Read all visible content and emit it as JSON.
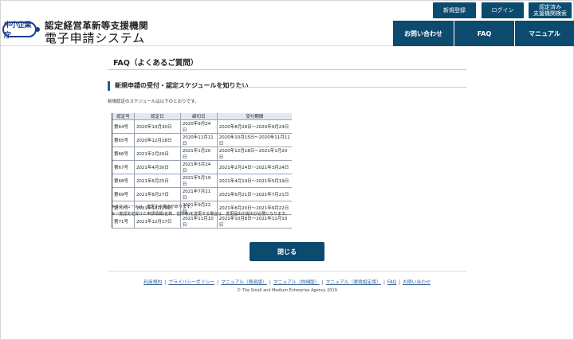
{
  "header": {
    "logo_badge": "中小企業庁",
    "brand_sub": "認定経営革新等支援機関",
    "brand_main": "電子申請システム",
    "top_buttons": {
      "register": "新規登録",
      "login": "ログイン",
      "search_line1": "認定済み",
      "search_line2": "支援機関検索"
    },
    "nav": {
      "contact": "お問い合わせ",
      "faq": "FAQ",
      "manual": "マニュアル"
    }
  },
  "main": {
    "page_title": "FAQ（よくあるご質問）",
    "section_title": "新規申請の受付・認定スケジュールを知りたい",
    "intro": "新規認定のスケジュールは以下のとおりです。",
    "table": {
      "headers": [
        "認定号",
        "認定日",
        "締切日",
        "受付期間"
      ],
      "rows": [
        [
          "第64号",
          "2020年10月30日",
          "2020年9月24日",
          "2020年8月28日～2020年9月24日"
        ],
        [
          "第65号",
          "2020年12月18日",
          "2020年11月11日",
          "2020年10月15日～2020年11月11日"
        ],
        [
          "第66号",
          "2021年2月26日",
          "2021年1月20日",
          "2020年12月18日～2021年1月20日"
        ],
        [
          "第67号",
          "2021年4月30日",
          "2021年3月24日",
          "2021年2月24日～2021年3月24日"
        ],
        [
          "第68号",
          "2021年6月25日",
          "2021年5月19日",
          "2021年4月19日～2021年5月19日"
        ],
        [
          "第69号",
          "2021年8月27日",
          "2021年7月21日",
          "2021年6月21日～2021年7月21日"
        ],
        [
          "第70号",
          "2021年10月29日",
          "2021年9月22日",
          "2021年8月20日～2021年9月22日"
        ],
        [
          "第71号",
          "2021年12月17日",
          "2021年11月10日",
          "2021年10月8日～2021年11月10日"
        ]
      ]
    },
    "notes": [
      "※スケジュールは、変更する場合があります。",
      "※一度認定を受けた申請情報(名称、住所等)を変更する場合は、変更届出の提出が必要になります。"
    ],
    "close_button": "閉じる"
  },
  "footer": {
    "links": [
      "利用規約",
      "プライバシーポリシー",
      "マニュアル（簡易版）",
      "マニュアル（詳細版）",
      "マニュアル（環境設定版）",
      "FAQ",
      "お問い合わせ"
    ],
    "separator": "|",
    "copyright": "© The Small and Medium Enterprise Agency 2019"
  },
  "colors": {
    "primary": "#0c4a6e",
    "logo": "#1d3f8c",
    "link": "#2a5d96",
    "table_header": "#e2e8f1"
  }
}
